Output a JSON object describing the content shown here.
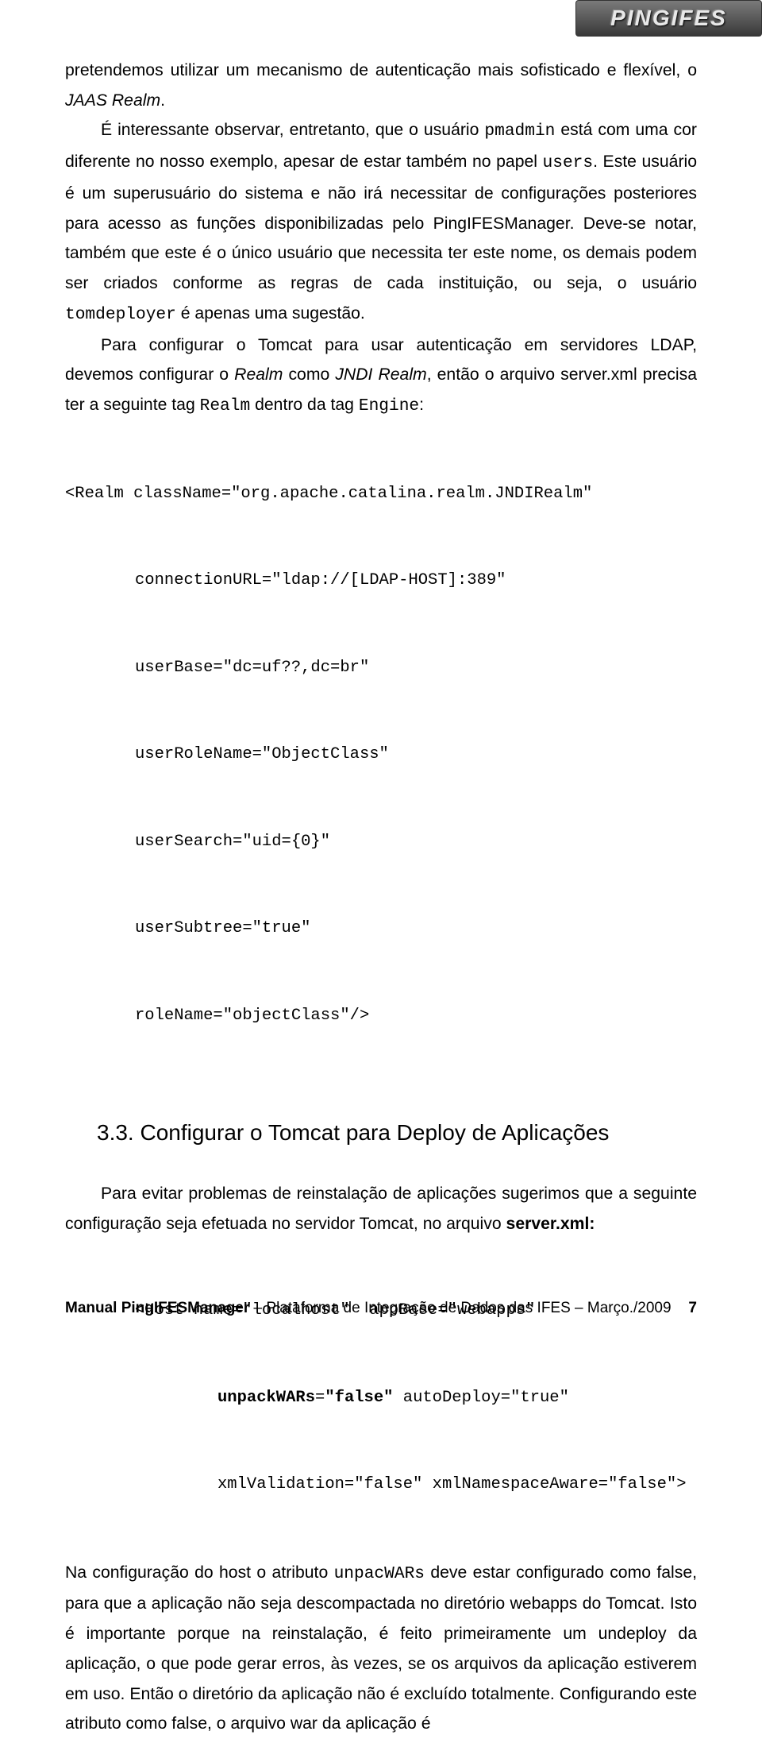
{
  "logo": "PINGIFES",
  "body": {
    "p1_a": "pretendemos utilizar um mecanismo de autenticação mais sofisticado e flexível, o ",
    "p1_i": "JAAS Realm",
    "p1_b": ".",
    "p2_a": "É interessante observar, entretanto, que o usuário ",
    "p2_m1": "pmadmin",
    "p2_b": " está com uma cor diferente no nosso exemplo, apesar de estar também no papel ",
    "p2_m2": "users",
    "p2_c": ". Este usuário é um superusuário do sistema e não irá necessitar de configurações posteriores para acesso as funções disponibilizadas pelo PingIFESManager. Deve-se notar, também que este é o único usuário que necessita ter este nome, os demais podem ser criados conforme as regras de cada instituição, ou seja, o usuário ",
    "p2_m3": "tomdeployer",
    "p2_d": " é apenas uma sugestão.",
    "p3_a": "Para configurar o Tomcat para usar autenticação em servidores LDAP, devemos configurar o ",
    "p3_i1": "Realm",
    "p3_b": " como ",
    "p3_i2": "JNDI Realm",
    "p3_c": ", então o arquivo server.xml precisa ter a seguinte tag ",
    "p3_m1": "Realm",
    "p3_d": " dentro da tag ",
    "p3_m2": "Engine",
    "p3_e": ":",
    "code1": {
      "l1": "<Realm className=\"org.apache.catalina.realm.JNDIRealm\"",
      "l2": "connectionURL=\"ldap://[LDAP-HOST]:389\"",
      "l3": "userBase=\"dc=uf??,dc=br\"",
      "l4": "userRoleName=\"ObjectClass\"",
      "l5": "userSearch=\"uid={0}\"",
      "l6": "userSubtree=\"true\"",
      "l7": "roleName=\"objectClass\"/>"
    },
    "h2": "3.3.  Configurar o Tomcat para Deploy de Aplicações",
    "p4_a": "Para evitar problemas de reinstalação de aplicações sugerimos que a seguinte configuração seja efetuada no servidor Tomcat, no arquivo ",
    "p4_b": "server.xml:",
    "code2": {
      "l1": "<Host name=\"localhost\"  appBase=\"webapps\"",
      "l2a": "unpackWARs",
      "l2b": "=",
      "l2c": "\"false\"",
      "l2d": " autoDeploy=\"true\"",
      "l3": "xmlValidation=\"false\" xmlNamespaceAware=\"false\">"
    },
    "p5_a": "Na configuração do host o atributo ",
    "p5_m1": "unpacWARs",
    "p5_b": " deve estar configurado como false, para que a aplicação não seja descompactada no diretório webapps do Tomcat. Isto é importante porque na reinstalação, é feito primeiramente um undeploy da aplicação, o que pode gerar erros, às vezes, se os arquivos da aplicação estiverem em uso. Então o diretório da aplicação não é excluído totalmente. Configurando este atributo como false, o arquivo war da aplicação é"
  },
  "footer": {
    "title_bold": "Manual PingIFESManager",
    "title_rest": " – Plataforma de Integração de Dados das IFES – Março./2009",
    "page": "7"
  }
}
